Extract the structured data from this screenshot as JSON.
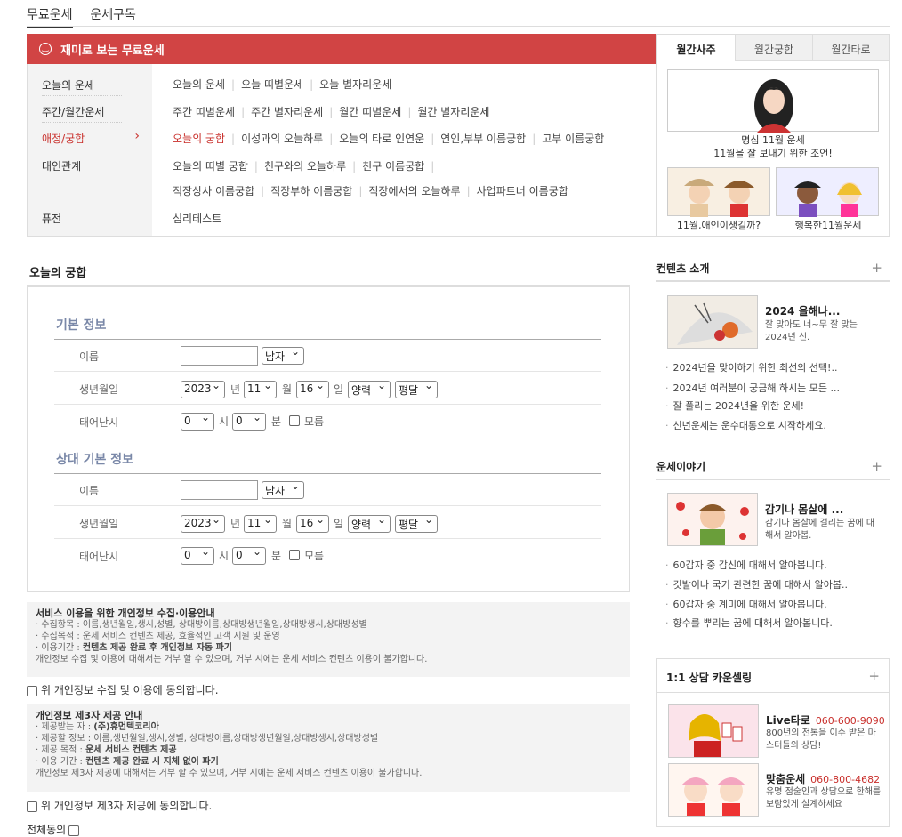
{
  "top_tabs": [
    "무료운세",
    "운세구독"
  ],
  "banner": {
    "title": "재미로 보는 무료운세"
  },
  "categories": [
    {
      "label": "오늘의 운세",
      "active": false
    },
    {
      "label": "주간/월간운세",
      "active": false
    },
    {
      "label": "애정/궁합",
      "active": true
    },
    {
      "label": "대인관계",
      "active": false
    },
    {
      "label": "퓨전",
      "active": false
    }
  ],
  "links": {
    "row1": [
      "오늘의 운세",
      "오늘 띠별운세",
      "오늘 별자리운세"
    ],
    "row2": [
      "주간 띠별운세",
      "주간 별자리운세",
      "월간 띠별운세",
      "월간 별자리운세"
    ],
    "row3": [
      "오늘의 궁합",
      "이성과의 오늘하루",
      "오늘의 타로 인연운",
      "연인,부부 이름궁합",
      "고부 이름궁합"
    ],
    "row4": [
      "오늘의 띠별 궁합",
      "친구와의 오늘하루",
      "친구 이름궁합"
    ],
    "row5": [
      "직장상사 이름궁합",
      "직장부하 이름궁합",
      "직장에서의 오늘하루",
      "사업파트너 이름궁합"
    ],
    "row6": [
      "심리테스트"
    ]
  },
  "right_tabs": [
    "월간사주",
    "월간궁합",
    "월간타로"
  ],
  "monthly": {
    "main_caption_1": "명심 11월 운세",
    "main_caption_2": "11월을 잘 보내기 위한 조언!",
    "cap_left": "11월,애인이생길까?",
    "cap_right": "행복한11월운세"
  },
  "section_title": "오늘의 궁합",
  "form": {
    "basic_title": "기본 정보",
    "partner_title": "상대 기본 정보",
    "name_label": "이름",
    "birth_label": "생년월일",
    "time_label": "태어난시",
    "gender": "남자",
    "year": "2023",
    "year_unit": "년",
    "month": "11",
    "month_unit": "월",
    "day": "16",
    "day_unit": "일",
    "calendar": "양력",
    "leap": "평달",
    "hour": "0",
    "hour_unit": "시",
    "minute": "0",
    "minute_unit": "분",
    "unknown": "모름"
  },
  "privacy1": {
    "title": "서비스 이용을 위한 개인정보 수집·이용안내",
    "line1": "· 수집항목 : 이름,생년월일,생시,성별, 상대방이름,상대방생년월일,상대방생시,상대방성별",
    "line2": "· 수집목적 : 운세 서비스 컨텐츠 제공, 효율적인 고객 지원 및 운영",
    "line3_prefix": "· 이용기간 : ",
    "line3_bold": "컨텐츠 제공 완료 후 개인정보 자동 파기",
    "line4": "개인정보 수집 및 이용에 대해서는 거부 할 수 있으며, 거부 시에는 운세 서비스 컨텐츠 이용이 불가합니다.",
    "agree": "위 개인정보 수집 및 이용에 동의합니다."
  },
  "privacy2": {
    "title": "개인정보 제3자 제공 안내",
    "line1_prefix": "· 제공받는 자 : ",
    "line1_bold": "(주)휴먼텍코리아",
    "line2": "· 제공할 정보 : 이름,생년월일,생시,성별, 상대방이름,상대방생년월일,상대방생시,상대방성별",
    "line3_prefix": "· 제공 목적 : ",
    "line3_bold": "운세 서비스 컨텐츠 제공",
    "line4_prefix": "· 이용 기간 : ",
    "line4_bold": "컨텐츠 제공 완료 시 지체 없이 파기",
    "line5": "개인정보 제3자 제공에 대해서는 거부 할 수 있으며, 거부 시에는 운세 서비스 컨텐츠 이용이 불가합니다.",
    "agree": "위 개인정보 제3자 제공에 동의합니다."
  },
  "agree_all": "전체동의",
  "content_intro": {
    "title": "컨텐츠 소개",
    "plus": "+",
    "feature_title": "2024 올해나...",
    "feature_desc": "잘 맞아도 너~무 잘 맞는 2024년 신.",
    "items": [
      "2024년을 맞이하기 위한 최선의 선택!..",
      "2024년 여러분이 궁금해 하시는 모든 ...",
      "잘 풀리는 2024년을 위한 운세!",
      "신년운세는 운수대통으로 시작하세요."
    ]
  },
  "story": {
    "title": "운세이야기",
    "plus": "+",
    "feature_title": "감기나 몸살에 ...",
    "feature_desc": "감기나 몸살에 걸리는 꿈에 대해서 알아봅.",
    "items": [
      "60갑자 중 갑신에 대해서 알아봅니다.",
      "깃발이나 국기 관련한 꿈에 대해서 알아봅..",
      "60갑자 중 계미에 대해서 알아봅니다.",
      "향수를 뿌리는 꿈에 대해서 알아봅니다."
    ]
  },
  "counsel": {
    "title": "1:1 상담 카운셀링",
    "plus": "+",
    "a_title": "Live타로",
    "a_phone": "060-600-9090",
    "a_desc": "800년의 전통을 이수 받은 마스터들의 상담!",
    "b_title": "맞춤운세",
    "b_phone": "060-800-4682",
    "b_desc": "유명 점술인과 상담으로 한해를 보람있게 설계하세요"
  }
}
